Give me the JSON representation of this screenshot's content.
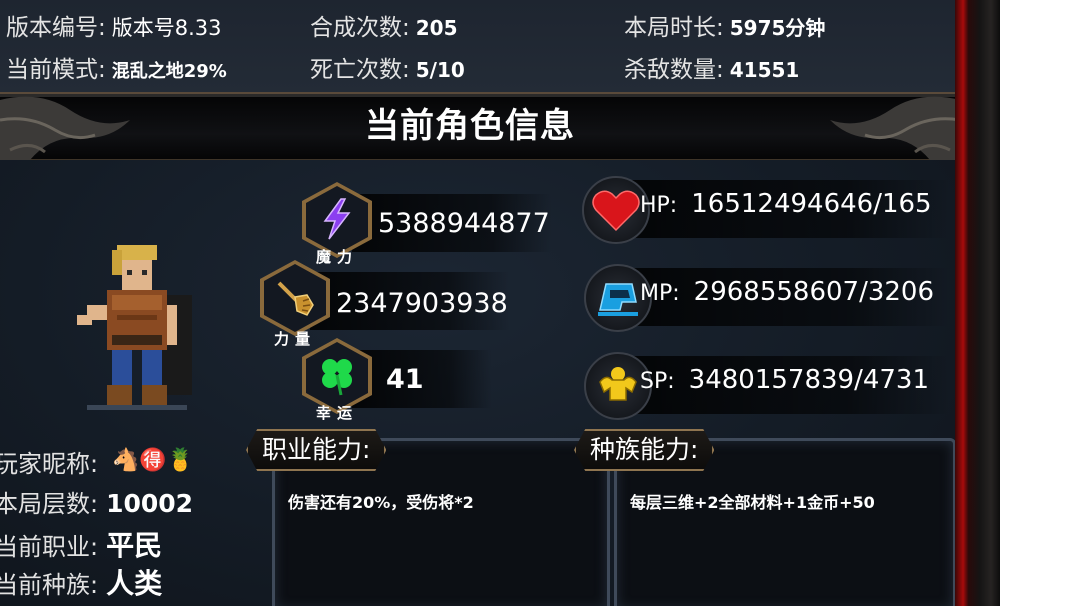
{
  "top_stats": {
    "version": {
      "label": "版本编号:",
      "value": "版本号8.33"
    },
    "merges": {
      "label": "合成次数:",
      "value": "205"
    },
    "duration": {
      "label": "本局时长:",
      "value": "5975分钟"
    },
    "mode": {
      "label": "当前模式:",
      "value": "混乱之地29%"
    },
    "deaths": {
      "label": "死亡次数:",
      "value": "5/10"
    },
    "kills": {
      "label": "杀敌数量:",
      "value": "41551"
    }
  },
  "title": "当前角色信息",
  "attributes": {
    "magic": {
      "label": "魔力",
      "value": "5388944877",
      "icon": "lightning-icon"
    },
    "strength": {
      "label": "力量",
      "value": "2347903938",
      "icon": "fist-icon"
    },
    "luck": {
      "label": "幸运",
      "value": "41",
      "icon": "clover-icon"
    }
  },
  "resources": {
    "hp": {
      "label": "HP:",
      "value": "16512494646/165",
      "icon": "heart-icon"
    },
    "mp": {
      "label": "MP:",
      "value": "2968558607/3206",
      "icon": "mana-icon"
    },
    "sp": {
      "label": "SP:",
      "value": "3480157839/4731",
      "icon": "muscle-icon"
    }
  },
  "player": {
    "nickname_label": "玩家昵称:",
    "nickname_emojis": "🐴🉐🍍",
    "floor_label": "本局层数:",
    "floor_value": "10002",
    "job_label": "当前职业:",
    "job_value": "平民",
    "race_label": "当前种族:",
    "race_value": "人类"
  },
  "abilities": {
    "job": {
      "title": "职业能力:",
      "text": "伤害还有20%，受伤将*2"
    },
    "race": {
      "title": "种族能力:",
      "text": "每层三维+2全部材料+1金币+50"
    }
  },
  "colors": {
    "frame_red": "#a80b0b",
    "hex_border": "#8a6a3c",
    "panel_bg": "#141c26"
  }
}
